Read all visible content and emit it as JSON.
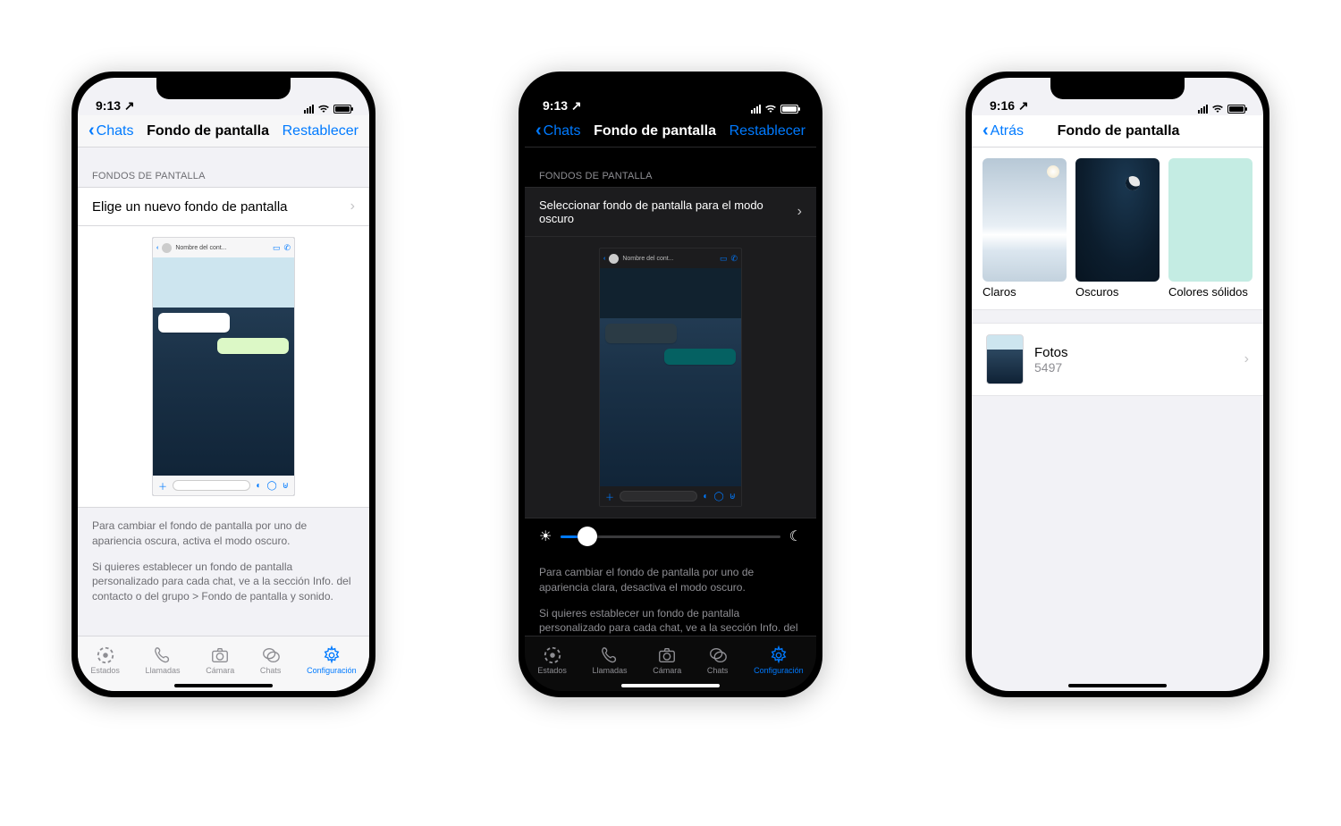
{
  "phone1": {
    "status_time": "9:13",
    "nav_back": "Chats",
    "nav_title": "Fondo de pantalla",
    "nav_right": "Restablecer",
    "section_label": "FONDOS DE PANTALLA",
    "choose_row": "Elige un nuevo fondo de pantalla",
    "preview_contact": "Nombre del cont...",
    "footer_a": "Para cambiar el fondo de pantalla por uno de apariencia oscura, activa el modo oscuro.",
    "footer_b": "Si quieres establecer un fondo de pantalla personalizado para cada chat, ve a la sección Info. del contacto o del grupo > Fondo de pantalla y sonido."
  },
  "phone2": {
    "status_time": "9:13",
    "nav_back": "Chats",
    "nav_title": "Fondo de pantalla",
    "nav_right": "Restablecer",
    "section_label": "FONDOS DE PANTALLA",
    "choose_row": "Seleccionar fondo de pantalla para el modo oscuro",
    "preview_contact": "Nombre del cont...",
    "footer_a": "Para cambiar el fondo de pantalla por uno de apariencia clara, desactiva el modo oscuro.",
    "footer_b": "Si quieres establecer un fondo de pantalla personalizado para cada chat, ve a la sección Info. del contacto o del"
  },
  "phone3": {
    "status_time": "9:16",
    "nav_back": "Atrás",
    "nav_title": "Fondo de pantalla",
    "cat_light": "Claros",
    "cat_dark": "Oscuros",
    "cat_solid": "Colores sólidos",
    "photos_label": "Fotos",
    "photos_count": "5497"
  },
  "tabs": {
    "status": "Estados",
    "calls": "Llamadas",
    "camera": "Cámara",
    "chats": "Chats",
    "settings": "Configuración"
  }
}
